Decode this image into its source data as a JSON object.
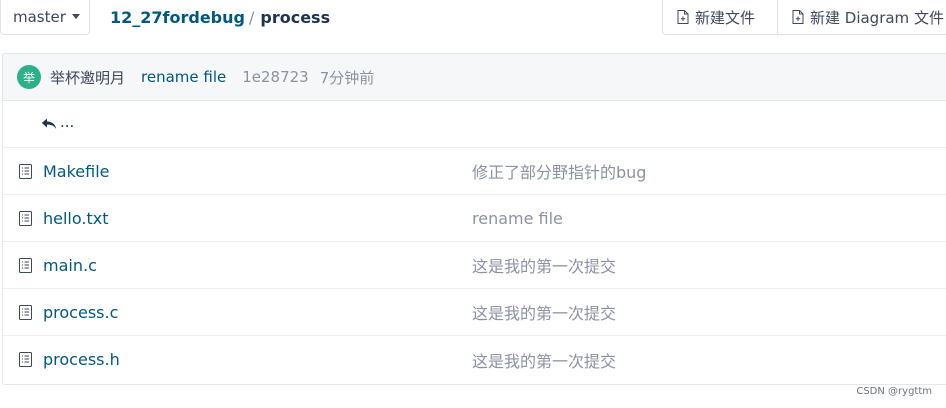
{
  "branch": {
    "label": "master"
  },
  "breadcrumb": {
    "repo": "12_27fordebug",
    "separator": "/",
    "current": "process"
  },
  "actions": {
    "new_file": "新建文件",
    "new_diagram": "新建 Diagram 文件"
  },
  "latest_commit": {
    "avatar_text": "举",
    "author": "举杯邀明月",
    "message": "rename file",
    "sha": "1e28723",
    "time": "7分钟前"
  },
  "parent_dir": {
    "label": "..."
  },
  "files": [
    {
      "name": "Makefile",
      "commit": "修正了部分野指针的bug"
    },
    {
      "name": "hello.txt",
      "commit": "rename file"
    },
    {
      "name": "main.c",
      "commit": "这是我的第一次提交"
    },
    {
      "name": "process.c",
      "commit": "这是我的第一次提交"
    },
    {
      "name": "process.h",
      "commit": "这是我的第一次提交"
    }
  ],
  "icons": {
    "file": "file-text-icon",
    "new_file": "file-plus-icon",
    "up": "reply-arrow-icon"
  },
  "colors": {
    "link": "#005980",
    "muted": "#8c92a4",
    "avatar": "#2bb08a"
  },
  "watermark": "CSDN @rygttm"
}
